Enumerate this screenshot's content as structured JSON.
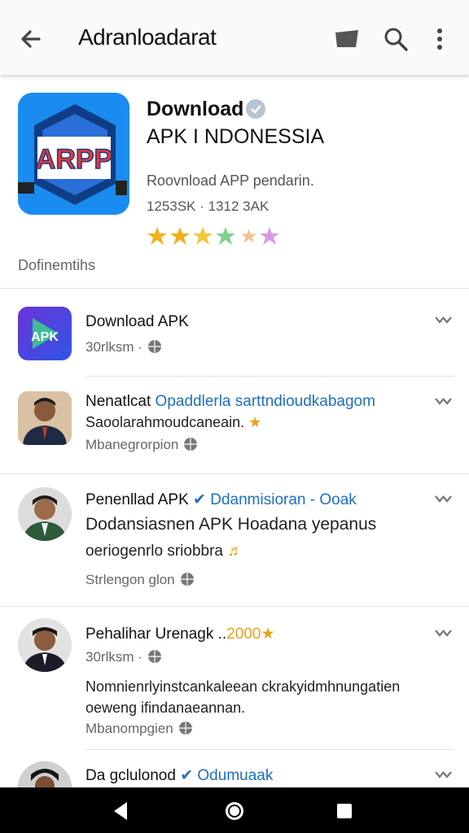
{
  "appbar": {
    "title": "Adranloadarat"
  },
  "hero": {
    "name_line1": "Download",
    "name_line2": "APK I NDONESSIA",
    "icon_text": "ARPP",
    "description": "Roovnload APP pendarin.",
    "stats": "1253SK · 1312 3AK",
    "rating": 3.5,
    "section_label": "Dofinemtihs"
  },
  "items": [
    {
      "title": "Download APK",
      "highlight": "",
      "gold": "",
      "subtitle": "",
      "subtitle2": "",
      "meta": "30rlksm ·",
      "icon_text": "APK"
    },
    {
      "title": "Nenatlcat ",
      "highlight": "Opaddlerla sarttndioudkabagom",
      "gold": "",
      "subtitle": "Saoolarahmoudcaneain.",
      "subtitle2": "",
      "meta": "Mbanegrorpion"
    },
    {
      "title": "Penenllad APK ",
      "highlight": "Ddanmisioran - Ooak",
      "gold": "",
      "subtitle": "Dodansiasnen APK Hoadana yepanus",
      "subtitle2": "oeriogenrlo sriobbra",
      "meta": "Strlengon glon"
    },
    {
      "title": "Pehalihar Urenagk ..",
      "highlight": "",
      "gold": "2000",
      "subtitle": "Nomnienrlyinstcankaleean ckrakyidmhnungatien",
      "subtitle2": "oeweng ifindanaeannan.",
      "meta": "30rlksm ·",
      "meta2": "Mbanompgien"
    },
    {
      "title": "Da gclulonod ",
      "highlight": "Odumuaak",
      "gold": "",
      "subtitle": "",
      "subtitle2": "",
      "meta": ""
    }
  ],
  "colors": {
    "accent": "#1e6fc0",
    "star": "#f2b01e",
    "appbar_bg": "#fafafa",
    "nav_bg": "#000000"
  },
  "icons": [
    "back-arrow-icon",
    "cast-icon",
    "search-icon",
    "more-vert-icon",
    "verified-icon",
    "globe-icon",
    "chevron-down-icon",
    "nav-back-icon",
    "nav-home-icon",
    "nav-recents-icon"
  ]
}
